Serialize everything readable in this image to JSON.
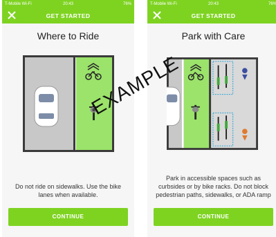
{
  "status_bar": {
    "carrier": "T-Mobile Wi-Fi",
    "time": "20:43",
    "battery": "76%"
  },
  "header": {
    "title": "GET STARTED",
    "close_icon": "close-icon"
  },
  "screens": [
    {
      "title": "Where to Ride",
      "caption": "Do not ride on sidewalks. Use the bike lanes when available.",
      "button": "CONTINUE"
    },
    {
      "title": "Park with Care",
      "caption": "Park in accessible spaces such as curbsides or by bike racks. Do not block pedestrian paths, sidewalks, or ADA ramp",
      "button": "CONTINUE"
    }
  ],
  "watermark": "EXAMPLE",
  "colors": {
    "accent": "#7ed321",
    "road": "#c8c8c8",
    "bike_lane": "#9be36a",
    "sidewalk": "#d9d9d9",
    "parking_outline": "#3aa9d6"
  }
}
